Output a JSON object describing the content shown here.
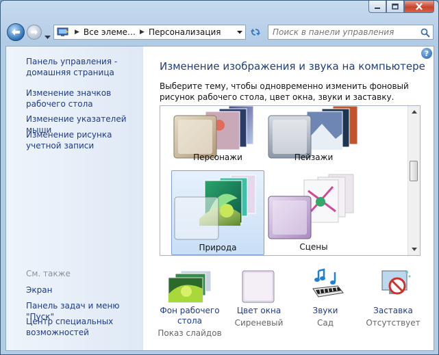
{
  "nav": {
    "breadcrumb": [
      "Все элеме…",
      "Персонализация"
    ],
    "search_placeholder": "Поиск в панели управления"
  },
  "sidebar": {
    "links": [
      "Панель управления - домашняя страница",
      "Изменение значков рабочего стола",
      "Изменение указателей мыши",
      "Изменение рисунка учетной записи"
    ],
    "see_also_title": "См. также",
    "see_also": [
      "Экран",
      "Панель задач и меню \"Пуск\"",
      "Центр специальных возможностей"
    ]
  },
  "main": {
    "title": "Изменение изображения и звука на компьютере",
    "description": "Выберите тему, чтобы одновременно изменить фоновый рисунок рабочего стола, цвет окна, звуки и заставку.",
    "themes": [
      {
        "name": "Персонажи",
        "selected": false
      },
      {
        "name": "Пейзажи",
        "selected": false
      },
      {
        "name": "Природа",
        "selected": true
      },
      {
        "name": "Сцены",
        "selected": false
      }
    ]
  },
  "options": [
    {
      "label": "Фон рабочего стола",
      "value": "Показ слайдов",
      "icon": "wallpaper-icon"
    },
    {
      "label": "Цвет окна",
      "value": "Сиреневый",
      "icon": "window-color-icon"
    },
    {
      "label": "Звуки",
      "value": "Сад",
      "icon": "sounds-icon"
    },
    {
      "label": "Заставка",
      "value": "Отсутствует",
      "icon": "screensaver-icon"
    }
  ],
  "colors": {
    "link": "#1e3a8a",
    "title": "#1e3d7a",
    "selection": "#c9dff6",
    "window_color": "#e8ddef"
  }
}
